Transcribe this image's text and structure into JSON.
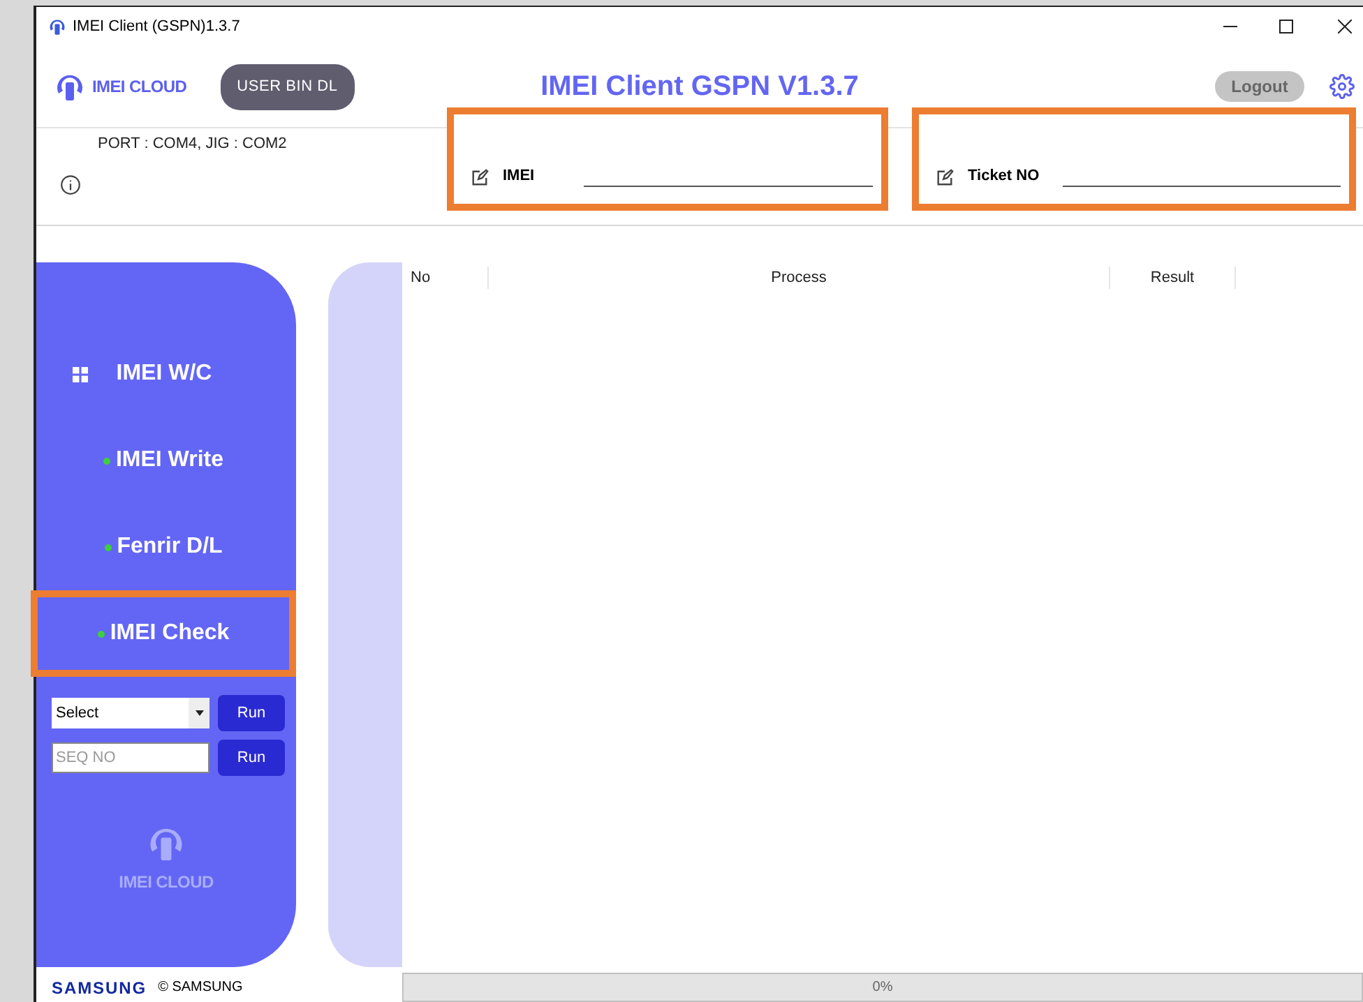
{
  "window": {
    "title": "IMEI Client (GSPN)1.3.7"
  },
  "header": {
    "logo_text": "IMEI CLOUD",
    "user_bin_button": "USER BIN DL",
    "app_title": "IMEI Client GSPN V1.3.7",
    "logout_button": "Logout"
  },
  "status": {
    "port_info": "PORT : COM4, JIG : COM2"
  },
  "fields": [
    {
      "label": "IMEI",
      "highlighted": true
    },
    {
      "label": "Ticket NO",
      "highlighted": true
    }
  ],
  "sidebar": {
    "items": [
      {
        "label": "IMEI W/C",
        "kind": "group",
        "highlighted": false
      },
      {
        "label": "IMEI Write",
        "kind": "item",
        "highlighted": false
      },
      {
        "label": "Fenrir D/L",
        "kind": "item",
        "highlighted": false
      },
      {
        "label": "IMEI Check",
        "kind": "item",
        "highlighted": true
      }
    ],
    "select": {
      "value": "Select",
      "button": "Run"
    },
    "seq": {
      "placeholder": "SEQ NO",
      "button": "Run"
    },
    "logo_text": "IMEI CLOUD"
  },
  "table": {
    "columns": [
      "No",
      "Process",
      "Result"
    ]
  },
  "progress": {
    "level": 0,
    "reading": "0%"
  },
  "footer": {
    "brand": "SAMSUNG",
    "copyright": "© SAMSUNG"
  }
}
